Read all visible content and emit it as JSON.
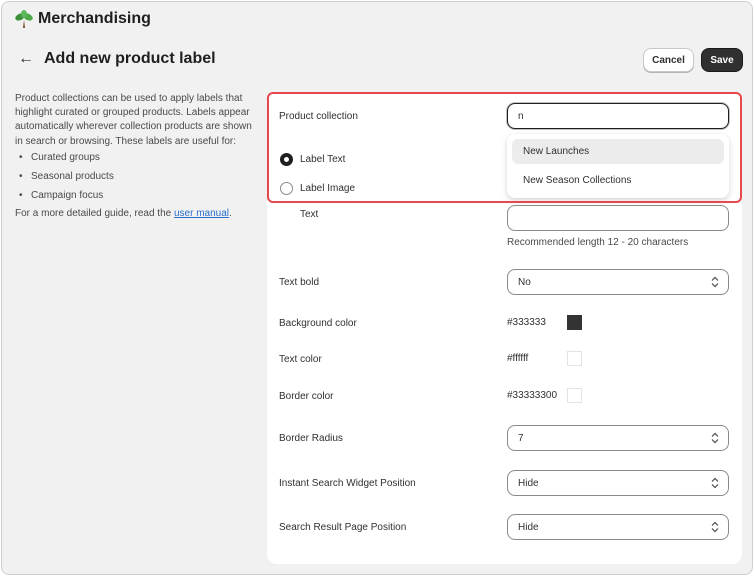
{
  "app": {
    "title": "Merchandising",
    "icon": "plant-icon"
  },
  "header": {
    "title": "Add new product label",
    "back_icon": "arrow-left-icon"
  },
  "actions": {
    "cancel_label": "Cancel",
    "save_label": "Save"
  },
  "description": {
    "text": "Product collections can be used to apply labels that highlight curated or grouped products. Labels appear automatically wherever collection products are shown in search or browsing. These labels are useful for:",
    "bullets": [
      "Curated groups",
      "Seasonal products",
      "Campaign focus"
    ],
    "guide_prefix": "For a more detailed guide, read the ",
    "guide_link": "user manual",
    "guide_suffix": "."
  },
  "form": {
    "product_collection": {
      "label": "Product collection",
      "value": "n",
      "options": [
        "New Launches",
        "New Season Collections"
      ],
      "highlighted_option": "New Launches"
    },
    "label_type": {
      "options": [
        "Label Text",
        "Label Image"
      ],
      "selected": "Label Text"
    },
    "text": {
      "label": "Text",
      "value": "",
      "help": "Recommended length 12 - 20 characters"
    },
    "text_bold": {
      "label": "Text bold",
      "value": "No"
    },
    "background_color": {
      "label": "Background color",
      "value": "#333333",
      "swatch": "#333333"
    },
    "text_color": {
      "label": "Text color",
      "value": "#ffffff",
      "swatch": "#ffffff"
    },
    "border_color": {
      "label": "Border color",
      "value": "#33333300",
      "swatch": "#ffffff"
    },
    "border_radius": {
      "label": "Border Radius",
      "value": "7"
    },
    "instant_search": {
      "label": "Instant Search Widget Position",
      "value": "Hide"
    },
    "search_result": {
      "label": "Search Result Page Position",
      "value": "Hide"
    }
  },
  "colors": {
    "highlight": "#e5484d",
    "primary_button": "#303030",
    "link": "#2c6ecb"
  }
}
